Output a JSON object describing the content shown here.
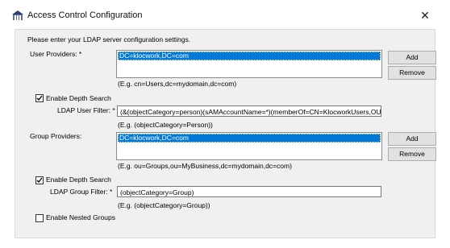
{
  "window": {
    "title": "Access Control Configuration",
    "app_icon": "app-icon",
    "close_glyph": "✕"
  },
  "intro": "Please enter your LDAP server configuration settings.",
  "user_providers": {
    "label": "User Providers: *",
    "items": [
      "DC=klocwork,DC=com"
    ],
    "add_label": "Add",
    "remove_label": "Remove",
    "hint": "(E.g. cn=Users,dc=mydomain,dc=com)"
  },
  "user_depth_search": {
    "label": "Enable Depth Search",
    "checked": true
  },
  "ldap_user_filter": {
    "label": "LDAP User Filter: *",
    "value": "(&(objectCategory=person)(sAMAccountName=*)(memberOf=CN=KlocworkUsers,OU=Groups",
    "hint": "(E.g. (objectCategory=Person))"
  },
  "group_providers": {
    "label": "Group Providers:",
    "items": [
      "DC=klocwork,DC=com"
    ],
    "add_label": "Add",
    "remove_label": "Remove",
    "hint": "(E.g. ou=Groups,ou=MyBusiness,dc=mydomain,dc=com)"
  },
  "group_depth_search": {
    "label": "Enable Depth Search",
    "checked": true
  },
  "ldap_group_filter": {
    "label": "LDAP Group Filter: *",
    "value": "(objectCategory=Group)",
    "hint": "(E.g. (objectCategory=Group))"
  },
  "nested_groups": {
    "label": "Enable Nested Groups",
    "checked": false
  },
  "colors": {
    "selection": "#0078d7",
    "panel_bg": "#f0f0f0",
    "button_bg": "#e1e1e1"
  }
}
